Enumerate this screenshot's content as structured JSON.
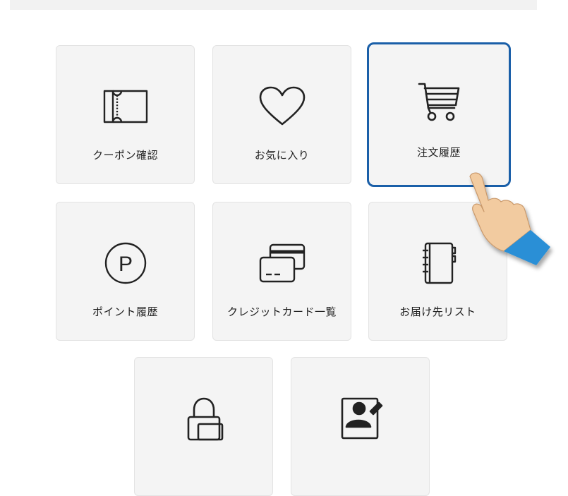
{
  "menu": {
    "items": [
      {
        "label": "クーポン確認",
        "icon": "coupon-icon"
      },
      {
        "label": "お気に入り",
        "icon": "heart-icon"
      },
      {
        "label": "注文履歴",
        "icon": "cart-icon",
        "selected": true
      },
      {
        "label": "ポイント履歴",
        "icon": "point-icon"
      },
      {
        "label": "クレジットカード一覧",
        "icon": "credit-card-icon"
      },
      {
        "label": "お届け先リスト",
        "icon": "address-book-icon"
      },
      {
        "label": "",
        "icon": "lock-icon"
      },
      {
        "label": "",
        "icon": "profile-edit-icon"
      }
    ],
    "point_symbol": "P"
  },
  "colors": {
    "tile_bg": "#f4f4f4",
    "selected_border": "#1a5fa8",
    "hand_skin": "#f2cba0",
    "hand_cuff": "#2a8fd6"
  }
}
